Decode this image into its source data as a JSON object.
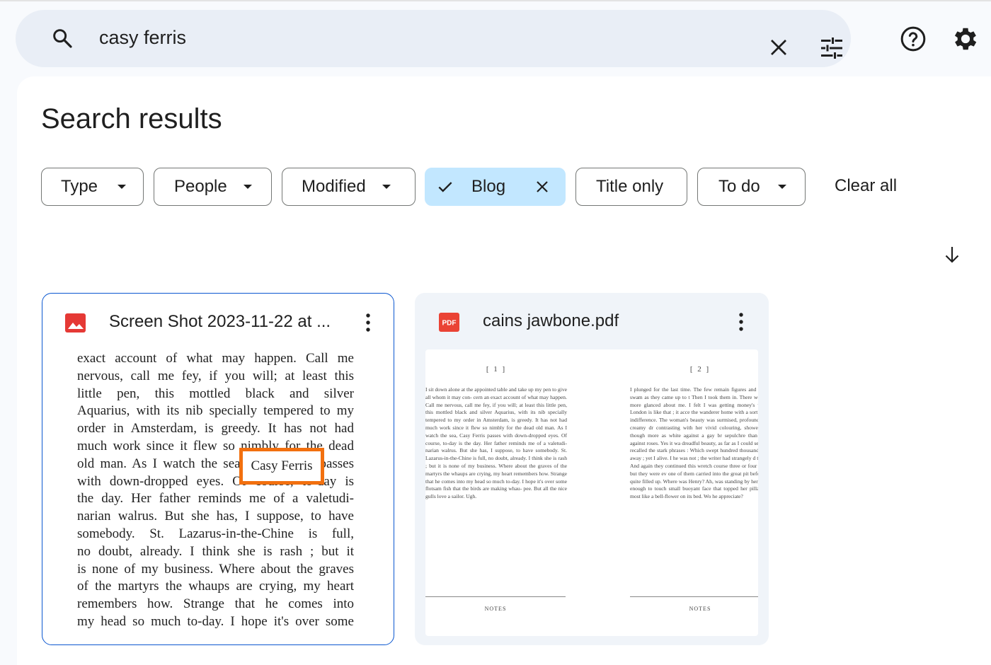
{
  "search": {
    "query": "casy ferris"
  },
  "page_title": "Search results",
  "filters": [
    {
      "label": "Type",
      "dropdown": true
    },
    {
      "label": "People",
      "dropdown": true
    },
    {
      "label": "Modified",
      "dropdown": true
    },
    {
      "label": "Blog",
      "selected": true
    },
    {
      "label": "Title only"
    },
    {
      "label": "To do",
      "dropdown": true
    }
  ],
  "clear_all_label": "Clear all",
  "icons": {
    "search": "search-icon",
    "clear": "close-icon",
    "tune": "tune-icon",
    "help": "help-icon",
    "settings": "gear-icon",
    "sort": "arrow-down-icon",
    "more": "more-vert-icon",
    "image": "image-file-icon",
    "pdf": "pdf-file-icon"
  },
  "colors": {
    "accent": "#0b57d0",
    "chip_selected": "#c2e7ff",
    "highlight": "#f2700f",
    "image_icon": "#e53935",
    "pdf_icon": "#ea4335"
  },
  "results": [
    {
      "name": "Screen Shot 2023-11-22 at ...",
      "highlight_text": "Casy Ferris",
      "preview_lines": [
        "exact account of what may happen. Call me",
        "nervous, call me fey, if you will; at least this",
        "little pen, this mottled black and silver",
        "Aquarius, with its nib specially tempered to my",
        "order in Amsterdam, is greedy. It has not had",
        "much work since it flew so nimbly for the dead",
        "old man. As I watch the sea, Casy Ferris passes",
        "with down-dropped eyes. Of course, to-day is",
        "the day. Her father reminds me of a valetudi-",
        "narian walrus. But she has, I suppose, to have",
        "somebody. St. Lazarus-in-the-Chine is full,",
        "no doubt, already. I think she is rash ; but it",
        "is none of my business. Where about the graves",
        "of the martyrs the whaups are crying, my heart",
        "remembers how. Strange that he comes into",
        "my head so much to-day. I hope it's over some"
      ]
    },
    {
      "name": "cains jawbone.pdf",
      "file_badge": "PDF",
      "pages": [
        {
          "number": "[ 1 ]",
          "text": "I sit down alone at the appointed table and take up my pen to give all whom it may con- cern an exact account of what may happen. Call me nervous, call me fey, if you will; at least this little pen, this mottled black and silver Aquarius, with its nib specially tempered to my order in Amsterdam, is greedy. It has not had much work since it flew so nimbly for the dead old man. As I watch the sea, Casy Ferris passes with down-dropped eyes. Of course, to-day is the day. Her father reminds me of a valetudi- narian walrus. But she has, I suppose, to have somebody. St. Lazarus-in-the-Chine is full, no doubt, already. I think she is rash ; but it is none of my business. Where about the graves of the martyrs the whaups are crying, my heart remembers how. Strange that he comes into my head so much to-day. I hope it's over some flotsam fish that the birds are making whau- pee. But all the nice gulls love a sailor. Ugh.",
          "footer": "NOTES"
        },
        {
          "number": "[ 2 ]",
          "text": "I plunged for the last time. The few remain figures and letters swam as they came up to t Then I took them in. There were no more glanced about me. I felt I was getting money's worth. London is like that ; it acce the wanderer home with a sort of wa indifference. The woman's beauty was surmised, profound : her creamy dr contrasting with her vivid colouring, showed me, though more as white against a gay br sepulchre than snow against roses. Yes it wa dreadful beauty, as far as I could see, and recalled the stark phrases : Which swept hundred thousand souls away ; yet I alive. I he was not ; the writer had strangely d to-day. And again they continued this wretch course three or four days ; but they were ev one of them carried into the great pit befor was quite filled up. Where was Henry? Ah, was standing by her, close enough to touch small buoyant face that topped her pilla neck most like a bell-flower on its bed. Wo he appreciate?",
          "footer": "NOTES"
        }
      ]
    }
  ]
}
